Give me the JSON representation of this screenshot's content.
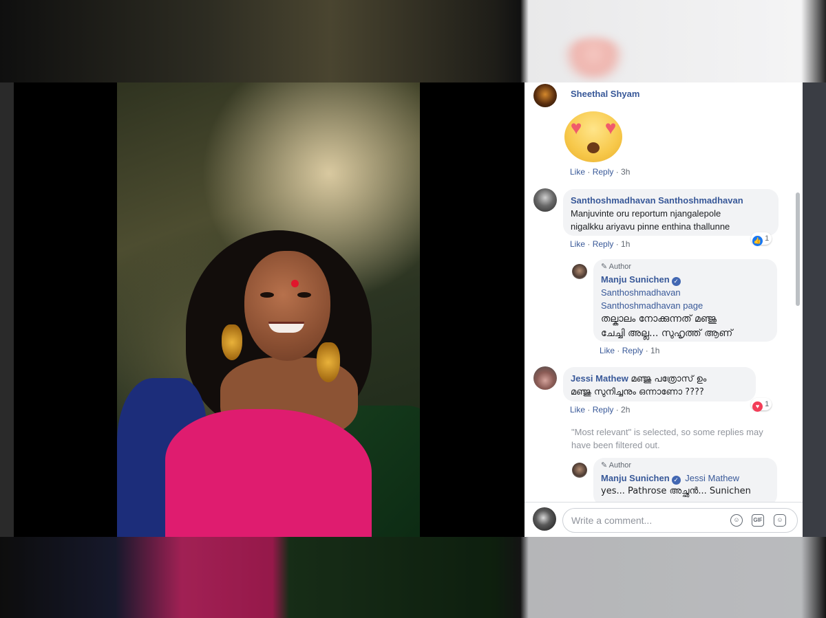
{
  "comments": [
    {
      "name": "Sheethal Shyam",
      "sticker": "heart-eyes-emoji",
      "like": "Like",
      "reply": "Reply",
      "time": "3h"
    },
    {
      "name": "Santhoshmadhavan Santhoshmadhavan",
      "text_line1": "Manjuvinte oru reportum njangalepole",
      "text_line2": "nigalkku ariyavu pinne enthina thallunne",
      "like": "Like",
      "reply": "Reply",
      "time": "1h",
      "reaction_count": "1",
      "reply_item": {
        "author_badge": "Author",
        "name": "Manju Sunichen",
        "mention_line1": "Santhoshmadhavan",
        "mention_line2": "Santhoshmadhavan page",
        "text_line1": "തല്കാലം നോക്കുന്നത് മഞ്ജു",
        "text_line2": "ചേച്ചി അല്ല... സുഹൃത്ത് ആണ്",
        "like": "Like",
        "reply": "Reply",
        "time": "1h"
      }
    },
    {
      "name": "Jessi Mathew",
      "text_line1": "മഞ്ജു പത്രോസ് ഉം",
      "text_line2": "മഞ്ജു സുനിച്ചനും ഒന്നാണോ ????",
      "like": "Like",
      "reply": "Reply",
      "time": "2h",
      "reaction_count": "1",
      "filter_notice_line1": "\"Most relevant\" is selected, so some replies may",
      "filter_notice_line2": "have been filtered out.",
      "reply_item": {
        "author_badge": "Author",
        "name": "Manju Sunichen",
        "mention": "Jessi Mathew",
        "text_line1": "yes... Pathrose അച്ഛൻ... Sunichen"
      }
    }
  ],
  "composer": {
    "placeholder": "Write a comment...",
    "gif_label": "GIF"
  },
  "colors": {
    "link": "#385898",
    "bubble": "#f2f3f5",
    "like_reaction": "#1877f2",
    "love_reaction": "#f33e58"
  }
}
